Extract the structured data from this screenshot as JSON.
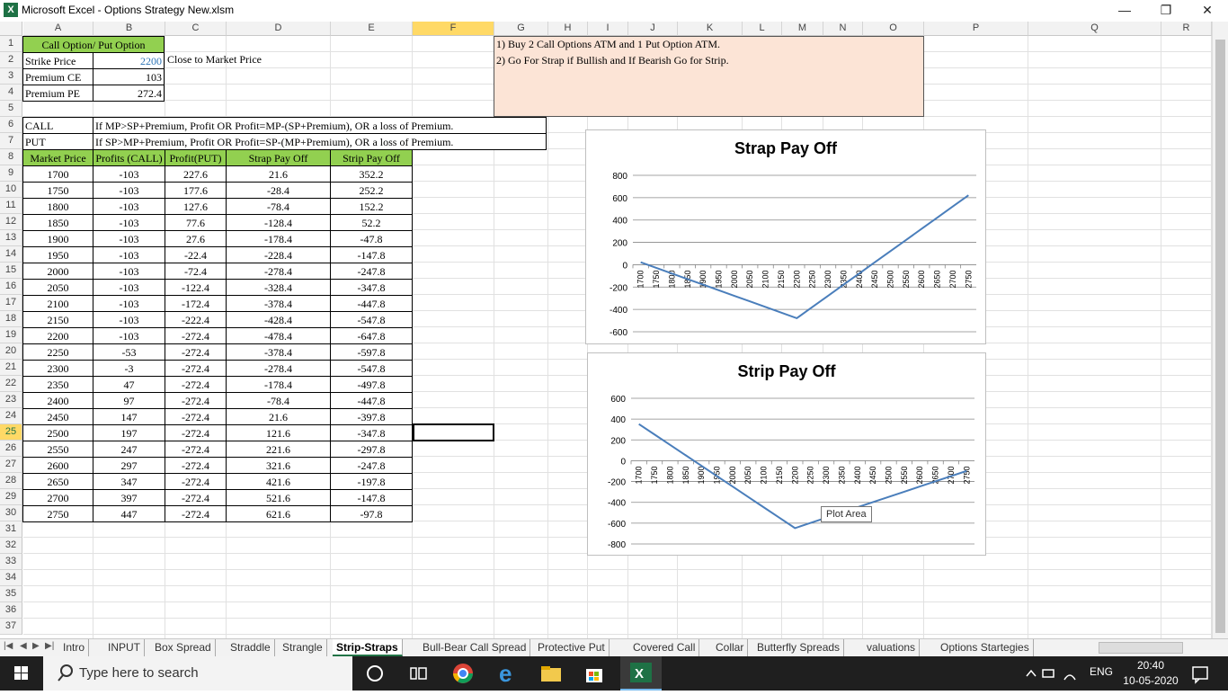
{
  "window": {
    "title": "Microsoft Excel - Options Strategy New.xlsm",
    "minimize": "—",
    "restore": "❐",
    "close": "✕"
  },
  "columns": [
    "A",
    "B",
    "C",
    "D",
    "E",
    "F",
    "G",
    "H",
    "I",
    "J",
    "K",
    "L",
    "M",
    "N",
    "O",
    "P",
    "Q",
    "R"
  ],
  "rows": [
    "1",
    "2",
    "3",
    "4",
    "5",
    "6",
    "7",
    "8",
    "9",
    "10",
    "11",
    "12",
    "13",
    "14",
    "15",
    "16",
    "17",
    "18",
    "19",
    "20",
    "21",
    "22",
    "23",
    "24",
    "25",
    "26",
    "27",
    "28",
    "29",
    "30",
    "31",
    "32",
    "33",
    "34",
    "35",
    "36",
    "37"
  ],
  "inputs": {
    "header": "Call Option/ Put Option",
    "strike_label": "Strike Price",
    "strike_value": "2200",
    "strike_note": "Close to Market Price",
    "premium_ce_label": "Premium CE",
    "premium_ce_value": "103",
    "premium_pe_label": "Premium PE",
    "premium_pe_value": "272.4"
  },
  "notes": [
    "1) Buy 2 Call Options ATM and 1 Put Option ATM.",
    "2) Go For Strap if Bullish and If Bearish Go for Strip."
  ],
  "rules": {
    "call_label": "CALL",
    "call_text": "If MP>SP+Premium, Profit OR Profit=MP-(SP+Premium), OR a loss of Premium.",
    "put_label": "PUT",
    "put_text": "If SP>MP+Premium, Profit OR Profit=SP-(MP+Premium), OR a loss of Premium."
  },
  "table": {
    "headers": [
      "Market Price",
      "Profits (CALL)",
      "Profit(PUT)",
      "Strap Pay Off",
      "Strip Pay Off"
    ],
    "rows": [
      [
        "1700",
        "-103",
        "227.6",
        "21.6",
        "352.2"
      ],
      [
        "1750",
        "-103",
        "177.6",
        "-28.4",
        "252.2"
      ],
      [
        "1800",
        "-103",
        "127.6",
        "-78.4",
        "152.2"
      ],
      [
        "1850",
        "-103",
        "77.6",
        "-128.4",
        "52.2"
      ],
      [
        "1900",
        "-103",
        "27.6",
        "-178.4",
        "-47.8"
      ],
      [
        "1950",
        "-103",
        "-22.4",
        "-228.4",
        "-147.8"
      ],
      [
        "2000",
        "-103",
        "-72.4",
        "-278.4",
        "-247.8"
      ],
      [
        "2050",
        "-103",
        "-122.4",
        "-328.4",
        "-347.8"
      ],
      [
        "2100",
        "-103",
        "-172.4",
        "-378.4",
        "-447.8"
      ],
      [
        "2150",
        "-103",
        "-222.4",
        "-428.4",
        "-547.8"
      ],
      [
        "2200",
        "-103",
        "-272.4",
        "-478.4",
        "-647.8"
      ],
      [
        "2250",
        "-53",
        "-272.4",
        "-378.4",
        "-597.8"
      ],
      [
        "2300",
        "-3",
        "-272.4",
        "-278.4",
        "-547.8"
      ],
      [
        "2350",
        "47",
        "-272.4",
        "-178.4",
        "-497.8"
      ],
      [
        "2400",
        "97",
        "-272.4",
        "-78.4",
        "-447.8"
      ],
      [
        "2450",
        "147",
        "-272.4",
        "21.6",
        "-397.8"
      ],
      [
        "2500",
        "197",
        "-272.4",
        "121.6",
        "-347.8"
      ],
      [
        "2550",
        "247",
        "-272.4",
        "221.6",
        "-297.8"
      ],
      [
        "2600",
        "297",
        "-272.4",
        "321.6",
        "-247.8"
      ],
      [
        "2650",
        "347",
        "-272.4",
        "421.6",
        "-197.8"
      ],
      [
        "2700",
        "397",
        "-272.4",
        "521.6",
        "-147.8"
      ],
      [
        "2750",
        "447",
        "-272.4",
        "621.6",
        "-97.8"
      ]
    ]
  },
  "chart_data": [
    {
      "type": "line",
      "title": "Strap Pay Off",
      "x": [
        "1700",
        "1750",
        "1800",
        "1850",
        "1900",
        "1950",
        "2000",
        "2050",
        "2100",
        "2150",
        "2200",
        "2250",
        "2300",
        "2350",
        "2400",
        "2450",
        "2500",
        "2550",
        "2600",
        "2650",
        "2700",
        "2750"
      ],
      "series": [
        {
          "values": [
            21.6,
            -28.4,
            -78.4,
            -128.4,
            -178.4,
            -228.4,
            -278.4,
            -328.4,
            -378.4,
            -428.4,
            -478.4,
            -378.4,
            -278.4,
            -178.4,
            -78.4,
            21.6,
            121.6,
            221.6,
            321.6,
            421.6,
            521.6,
            621.6
          ]
        }
      ],
      "yticks": [
        800,
        600,
        400,
        200,
        0,
        -200,
        -400,
        -600
      ],
      "ylim": [
        -600,
        800
      ],
      "color": "#4a7ebb"
    },
    {
      "type": "line",
      "title": "Strip Pay Off",
      "x": [
        "1700",
        "1750",
        "1800",
        "1850",
        "1900",
        "1950",
        "2000",
        "2050",
        "2100",
        "2150",
        "2200",
        "2250",
        "2300",
        "2350",
        "2400",
        "2450",
        "2500",
        "2550",
        "2600",
        "2650",
        "2700",
        "2750"
      ],
      "series": [
        {
          "values": [
            352.2,
            252.2,
            152.2,
            52.2,
            -47.8,
            -147.8,
            -247.8,
            -347.8,
            -447.8,
            -547.8,
            -647.8,
            -597.8,
            -547.8,
            -497.8,
            -447.8,
            -397.8,
            -347.8,
            -297.8,
            -247.8,
            -197.8,
            -147.8,
            -97.8
          ]
        }
      ],
      "yticks": [
        600,
        400,
        200,
        0,
        -200,
        -400,
        -600,
        -800
      ],
      "ylim": [
        -800,
        600
      ],
      "color": "#4a7ebb"
    }
  ],
  "tooltip": "Plot Area",
  "sheet_tabs": [
    "Intro",
    "INPUT",
    "Box Spread",
    "Straddle",
    "Strangle",
    "Strip-Straps",
    "Bull-Bear Call Spread",
    "Protective Put",
    "Covered Call",
    "Collar",
    "Butterfly Spreads",
    "valuations",
    "Options Startegies"
  ],
  "active_tab": "Strip-Straps",
  "taskbar": {
    "search_placeholder": "Type here to search",
    "lang": "ENG",
    "time": "20:40",
    "date": "10-05-2020"
  }
}
